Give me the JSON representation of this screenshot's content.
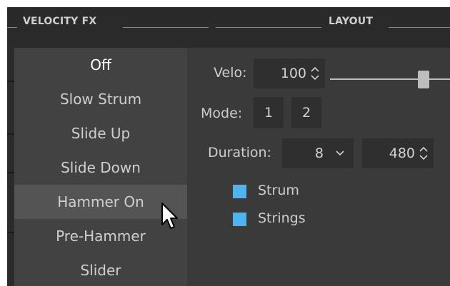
{
  "header": {
    "velocity_fx": "VELOCITY  FX",
    "layout": "LAYOUT"
  },
  "menu": {
    "items": [
      {
        "label": "Off",
        "state": "selected"
      },
      {
        "label": "Slow Strum",
        "state": "normal"
      },
      {
        "label": "Slide Up",
        "state": "normal"
      },
      {
        "label": "Slide Down",
        "state": "normal"
      },
      {
        "label": "Hammer On",
        "state": "hover"
      },
      {
        "label": "Pre-Hammer",
        "state": "normal"
      },
      {
        "label": "Slider",
        "state": "normal"
      }
    ]
  },
  "panel": {
    "velo": {
      "label": "Velo:",
      "value": "100",
      "slider_level": 0.85
    },
    "mode": {
      "label": "Mode:",
      "options": [
        "1",
        "2"
      ]
    },
    "duration": {
      "label": "Duration:",
      "select_value": "8",
      "spin_value": "480"
    },
    "checkboxes": [
      {
        "label": "Strum",
        "checked": true
      },
      {
        "label": "Strings",
        "checked": true
      }
    ]
  },
  "colors": {
    "accent": "#4fb3f0",
    "frame": "#3a3a3a",
    "menu": "#424242",
    "header": "#2a2a2a"
  },
  "icons": [
    "spinner-icon",
    "chevron-down-icon",
    "mouse-cursor-icon"
  ]
}
